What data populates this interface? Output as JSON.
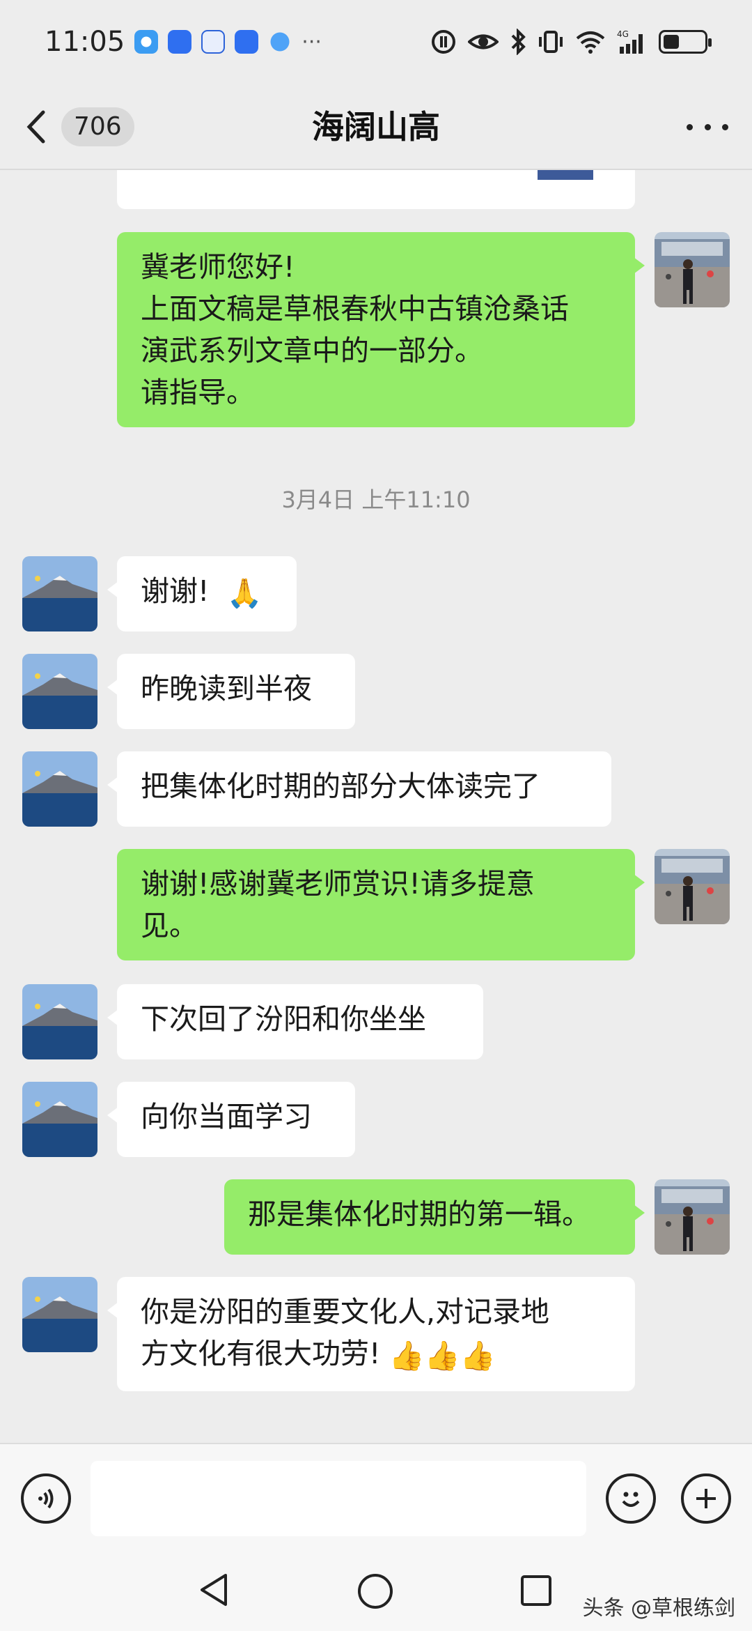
{
  "status_bar": {
    "time": "11:05",
    "notification_icons": [
      "qq-browser-icon",
      "tencent-app-icon",
      "baidu-icon",
      "cloud-app-icon",
      "globe-app-icon"
    ],
    "more": "···",
    "network_label": "4G",
    "battery_level": 0.4
  },
  "header": {
    "back_badge": "706",
    "title": "海阔山高"
  },
  "messages": [
    {
      "side": "out",
      "lines": [
        "冀老师您好!",
        "上面文稿是草根春秋中古镇沧桑话",
        "演武系列文章中的一部分。",
        "请指导。"
      ]
    },
    {
      "side": "in",
      "lines": [
        "谢谢!"
      ],
      "emoji": "🙏"
    },
    {
      "side": "in",
      "lines": [
        "昨晚读到半夜"
      ]
    },
    {
      "side": "in",
      "lines": [
        "把集体化时期的部分大体读完了"
      ]
    },
    {
      "side": "out",
      "lines": [
        "谢谢!感谢冀老师赏识!请多提意",
        "见。"
      ]
    },
    {
      "side": "in",
      "lines": [
        "下次回了汾阳和你坐坐"
      ]
    },
    {
      "side": "in",
      "lines": [
        "向你当面学习"
      ]
    },
    {
      "side": "out",
      "lines": [
        "那是集体化时期的第一辑。"
      ]
    },
    {
      "side": "in",
      "lines": [
        "你是汾阳的重要文化人,对记录地",
        "方文化有很大功劳!"
      ],
      "emoji": "👍👍👍"
    }
  ],
  "timestamp": "3月4日 上午11:10",
  "input_bar": {
    "voice_icon": "voice-icon",
    "emoji_icon": "smiley-icon",
    "plus_icon": "plus-icon",
    "input_value": ""
  },
  "system_nav": [
    "back-triangle-icon",
    "home-circle-icon",
    "recents-square-icon"
  ],
  "watermark": "头条 @草根练剑",
  "colors": {
    "outgoing_bubble": "#95ec69",
    "incoming_bubble": "#ffffff",
    "chat_background": "#ededed"
  }
}
